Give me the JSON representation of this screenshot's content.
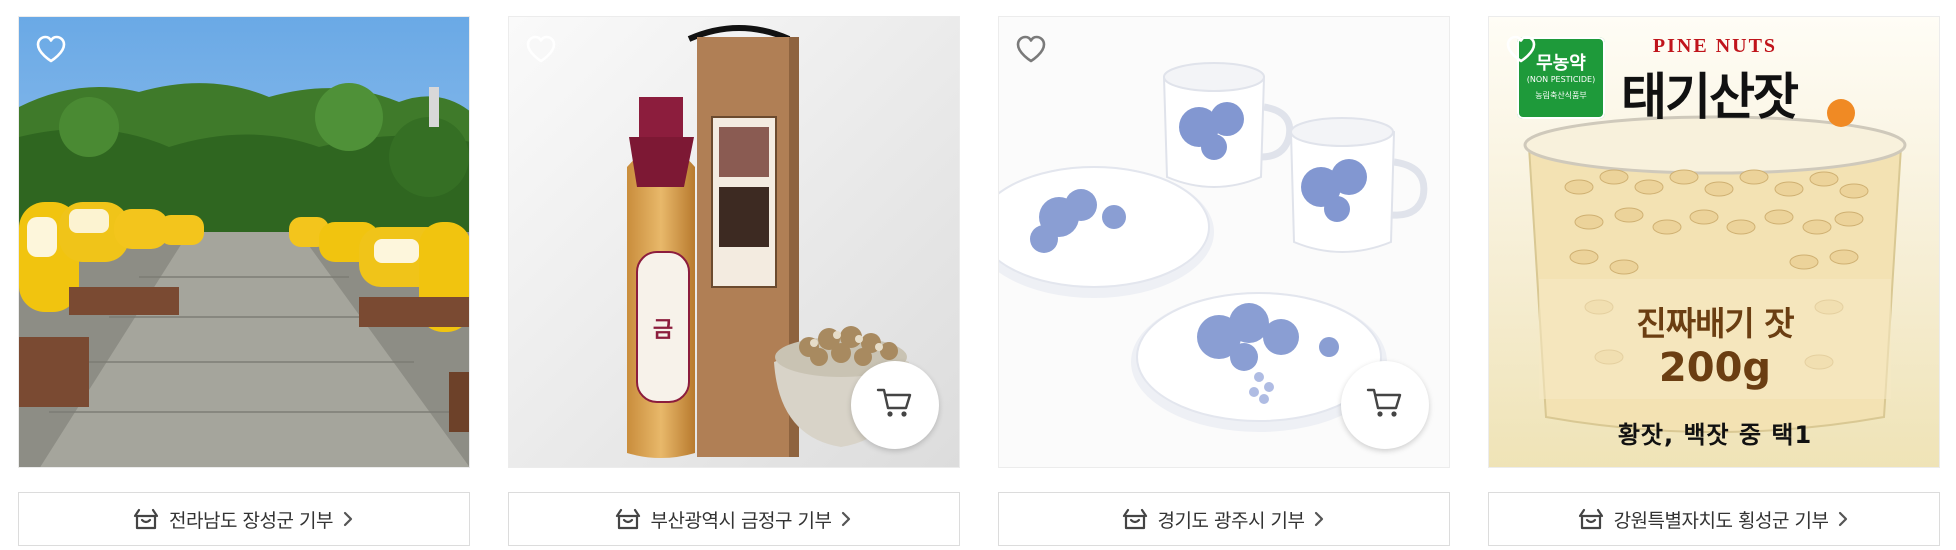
{
  "products": [
    {
      "image_alt": "",
      "has_cart_button": false,
      "donation_label": "전라남도 장성군 기부"
    },
    {
      "image_alt": "",
      "has_cart_button": true,
      "donation_label": "부산광역시 금정구 기부"
    },
    {
      "image_alt": "",
      "has_cart_button": true,
      "donation_label": "경기도 광주시 기부"
    },
    {
      "image_alt": "",
      "has_cart_button": false,
      "donation_label": "강원특별자치도 횡성군 기부",
      "package_text": {
        "brand_en": "PINE NUTS",
        "title": "태기산잣",
        "main": "진짜배기 잣",
        "weight": "200g",
        "sub": "황잣, 백잣 중 택1",
        "badge_main": "무농약",
        "badge_sub": "(NON PESTICIDE)",
        "badge_issuer": "농림축산식품부"
      }
    }
  ],
  "icons": {
    "wishlist": "heart-outline-icon",
    "cart": "shopping-cart-icon",
    "gift": "gift-box-icon",
    "chevron": "chevron-right-icon"
  },
  "colors": {
    "border": "#dcdcdc",
    "label_text": "#333333",
    "heart_stroke": "#ffffff"
  }
}
